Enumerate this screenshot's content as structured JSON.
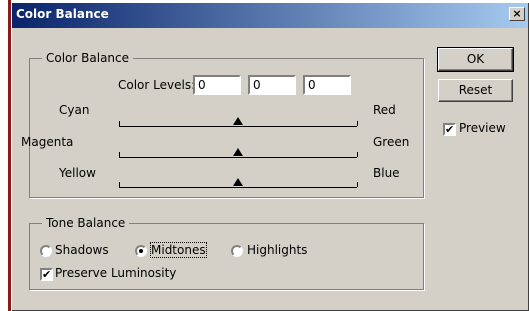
{
  "window": {
    "title": "Color Balance",
    "close_label": "×"
  },
  "color_balance": {
    "group_label": "Color Balance",
    "color_levels_label": "Color Levels:",
    "levels": [
      "0",
      "0",
      "0"
    ],
    "sliders": [
      {
        "left": "Cyan",
        "right": "Red",
        "value": 0
      },
      {
        "left": "Magenta",
        "right": "Green",
        "value": 0
      },
      {
        "left": "Yellow",
        "right": "Blue",
        "value": 0
      }
    ]
  },
  "tone_balance": {
    "group_label": "Tone Balance",
    "options": [
      "Shadows",
      "Midtones",
      "Highlights"
    ],
    "selected": "Midtones",
    "preserve_luminosity_label": "Preserve Luminosity",
    "preserve_luminosity_checked": true
  },
  "buttons": {
    "ok": "OK",
    "reset": "Reset"
  },
  "preview": {
    "label": "Preview",
    "checked": true
  },
  "check_mark": "✔"
}
